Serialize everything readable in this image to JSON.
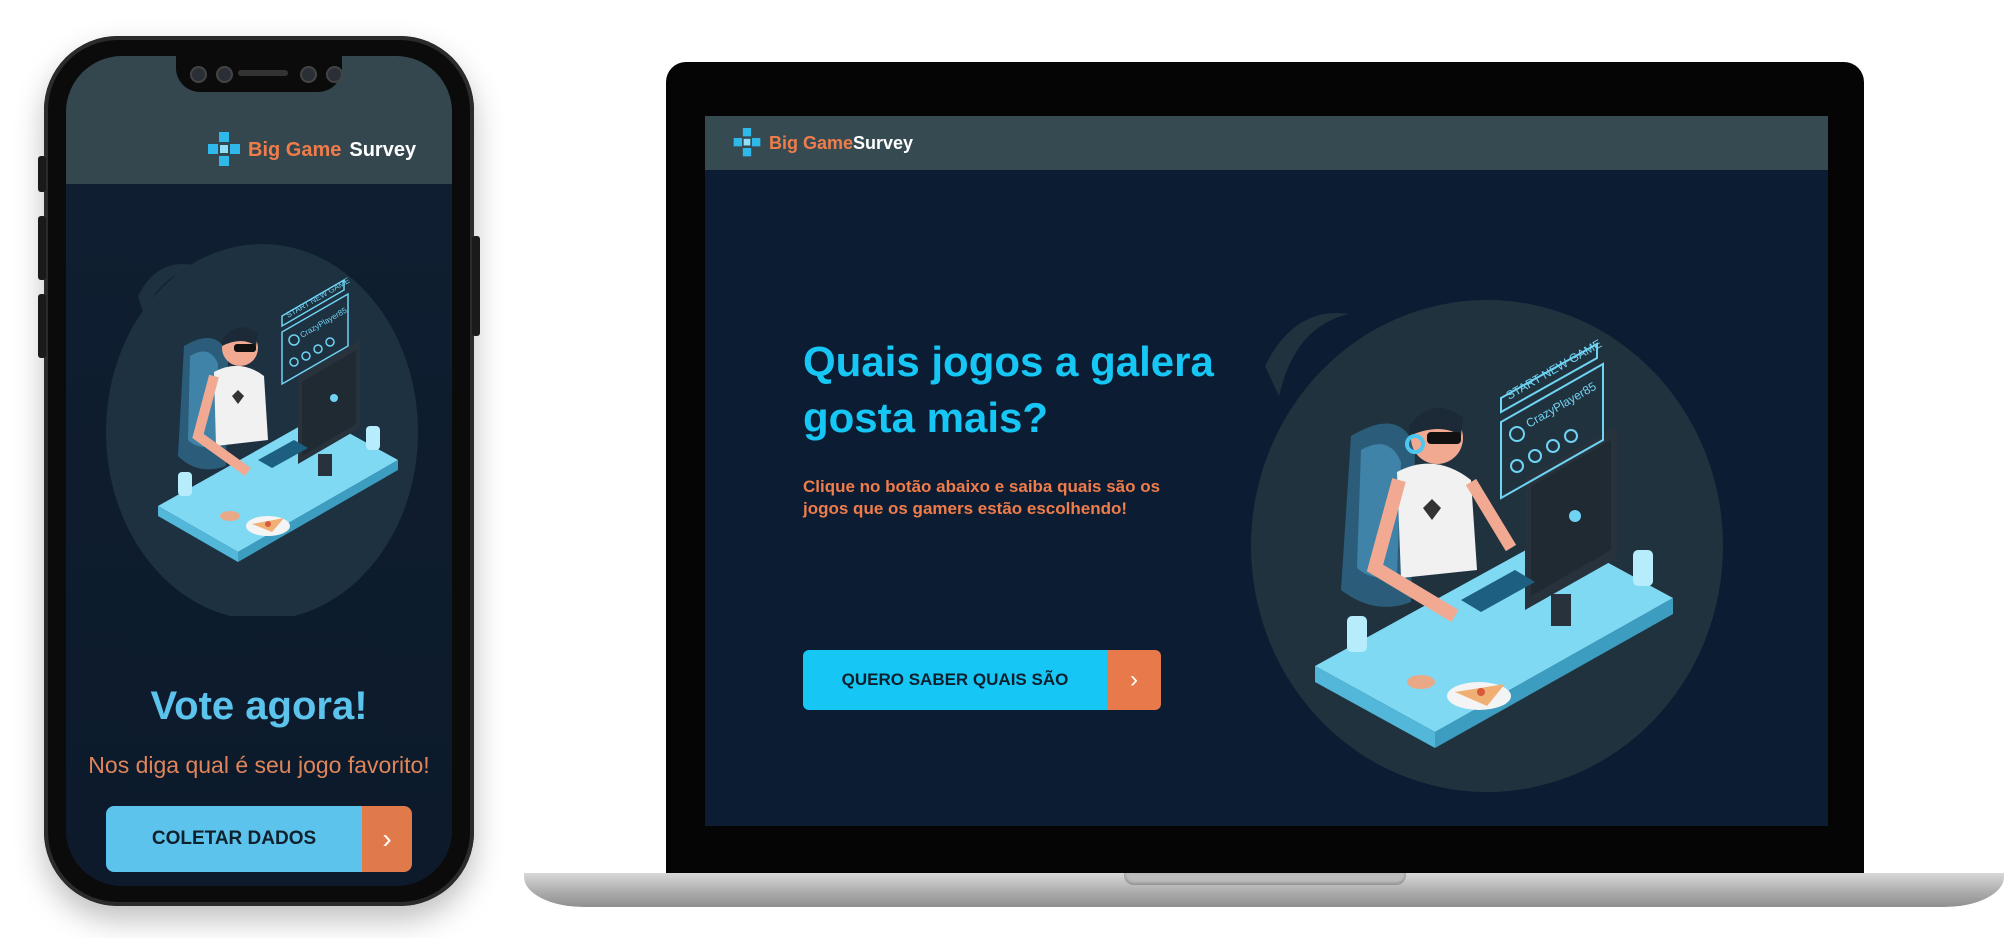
{
  "mobile": {
    "logo": {
      "brand_part1": "Big Game",
      "brand_part2": "Survey"
    },
    "illustration": {
      "screen_label": "START NEW GAME",
      "player_name": "CrazyPlayer85"
    },
    "title": "Vote agora!",
    "subtitle": "Nos diga qual é seu jogo favorito!",
    "button": {
      "label": "COLETAR DADOS",
      "arrow": "›"
    }
  },
  "desktop": {
    "logo": {
      "brand_part1": "Big Game",
      "brand_part2": "Survey"
    },
    "title": "Quais jogos a galera gosta mais?",
    "subtitle": "Clique no botão abaixo e saiba quais são os jogos que os gamers estão escolhendo!",
    "button": {
      "label": "QUERO SABER QUAIS SÃO",
      "arrow": "›"
    },
    "illustration": {
      "screen_label": "START NEW GAME",
      "player_name": "CrazyPlayer85"
    }
  },
  "colors": {
    "accent_cyan": "#16c6f4",
    "accent_orange": "#f07c4a",
    "header_bg": "#364a52",
    "page_bg": "#0c1d33"
  }
}
